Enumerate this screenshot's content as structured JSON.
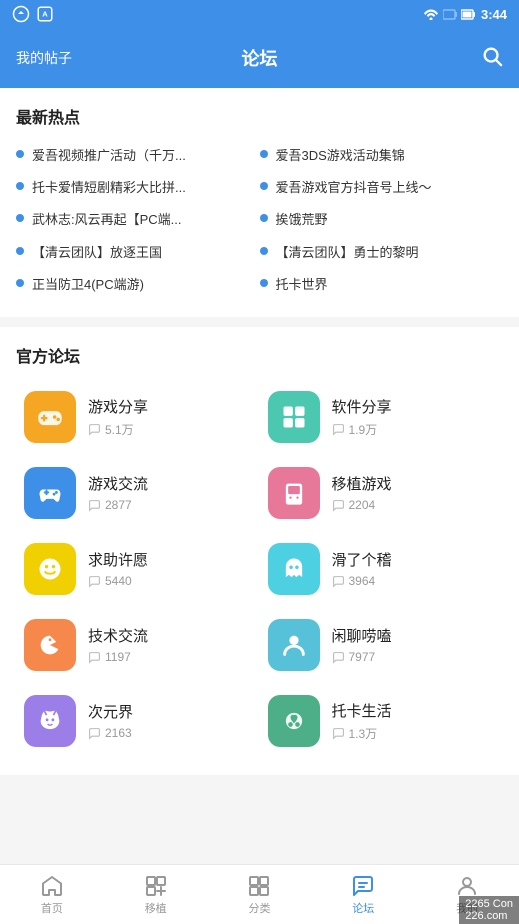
{
  "statusBar": {
    "time": "3:44"
  },
  "header": {
    "leftLabel": "我的帖子",
    "title": "论坛",
    "searchIcon": "search"
  },
  "hotSection": {
    "title": "最新热点",
    "topics": [
      {
        "text": "爱吾视频推广活动（千万..."
      },
      {
        "text": "爱吾3DS游戏活动集锦"
      },
      {
        "text": "托卡爱情短剧精彩大比拼..."
      },
      {
        "text": "爱吾游戏官方抖音号上线～"
      },
      {
        "text": "武林志:风云再起【PC端..."
      },
      {
        "text": "挨饿荒野"
      },
      {
        "text": "【清云团队】放逐王国"
      },
      {
        "text": "【清云团队】勇士的黎明"
      },
      {
        "text": "正当防卫4(PC端游)"
      },
      {
        "text": "托卡世界"
      }
    ]
  },
  "forumsSection": {
    "title": "官方论坛",
    "forums": [
      {
        "name": "游戏分享",
        "count": "5.1万",
        "color": "yellow",
        "icon": "gamepad"
      },
      {
        "name": "软件分享",
        "count": "1.9万",
        "color": "teal",
        "icon": "grid"
      },
      {
        "name": "游戏交流",
        "count": "2877",
        "color": "blue",
        "icon": "controller"
      },
      {
        "name": "移植游戏",
        "count": "2204",
        "color": "pink",
        "icon": "handheld"
      },
      {
        "name": "求助许愿",
        "count": "5440",
        "color": "yellow2",
        "icon": "smile"
      },
      {
        "name": "滑了个稽",
        "count": "3964",
        "color": "cyan",
        "icon": "ghost"
      },
      {
        "name": "技术交流",
        "count": "1197",
        "color": "orange",
        "icon": "pacman"
      },
      {
        "name": "闲聊唠嗑",
        "count": "7977",
        "color": "lightblue",
        "icon": "person"
      },
      {
        "name": "次元界",
        "count": "2163",
        "color": "purple",
        "icon": "fox"
      },
      {
        "name": "托卡生活",
        "count": "1.3万",
        "color": "green",
        "icon": "toca"
      }
    ]
  },
  "bottomNav": {
    "items": [
      {
        "label": "首页",
        "icon": "home",
        "active": false
      },
      {
        "label": "移植",
        "icon": "migrate",
        "active": false
      },
      {
        "label": "分类",
        "icon": "category",
        "active": false
      },
      {
        "label": "论坛",
        "icon": "forum",
        "active": true
      },
      {
        "label": "我的",
        "icon": "person",
        "active": false
      }
    ]
  },
  "watermark": "226.com"
}
